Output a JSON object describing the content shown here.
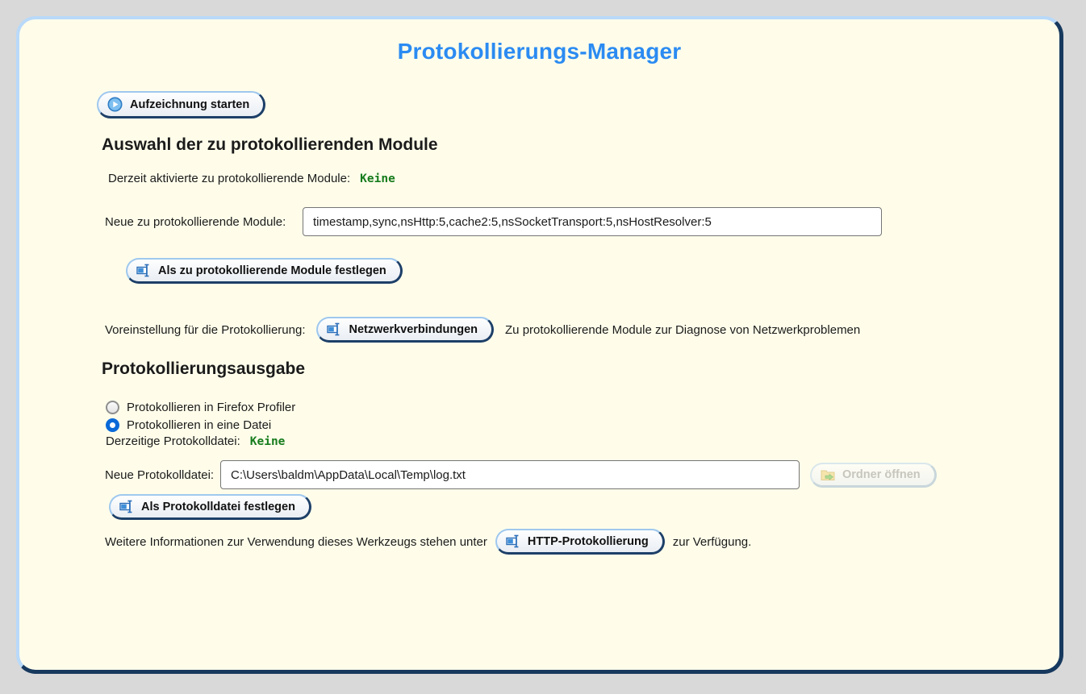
{
  "page": {
    "title": "Protokollierungs-Manager"
  },
  "colors": {
    "accent_blue": "#2b8bf2",
    "success_green": "#177c1d",
    "card_background": "#fffdea",
    "border_light_blue": "#b9d9f9",
    "border_dark_navy": "#17395e"
  },
  "toolbar": {
    "start_button_label": "Aufzeichnung starten"
  },
  "modules_section": {
    "heading": "Auswahl der zu protokollierenden Module",
    "current_modules_label": "Derzeit aktivierte zu protokollierende Module:",
    "current_modules_value": "Keine",
    "new_modules_label": "Neue zu protokollierende Module:",
    "new_modules_value": "timestamp,sync,nsHttp:5,cache2:5,nsSocketTransport:5,nsHostResolver:5",
    "set_modules_button_label": "Als zu protokollierende Module festlegen",
    "preset_label": "Voreinstellung für die Protokollierung:",
    "preset_button_label": "Netzwerkverbindungen",
    "preset_description": "Zu protokollierende Module zur Diagnose von Netzwerkproblemen"
  },
  "output_section": {
    "heading": "Protokollierungsausgabe",
    "radio_profiler_label": "Protokollieren in Firefox Profiler",
    "radio_file_label": "Protokollieren in eine Datei",
    "selected_radio": "file",
    "current_logfile_label": "Derzeitige Protokolldatei:",
    "current_logfile_value": "Keine",
    "new_logfile_label": "Neue Protokolldatei:",
    "new_logfile_value": "C:\\Users\\baldm\\AppData\\Local\\Temp\\log.txt",
    "open_folder_button_label": "Ordner öffnen",
    "set_logfile_button_label": "Als Protokolldatei festlegen"
  },
  "footer": {
    "info_prefix": "Weitere Informationen zur Verwendung dieses Werkzeugs stehen unter",
    "info_button_label": "HTTP-Protokollierung",
    "info_suffix": "zur Verfügung."
  },
  "icons": {
    "start": "play-icon",
    "set": "set-value-icon",
    "folder": "folder-open-icon"
  }
}
